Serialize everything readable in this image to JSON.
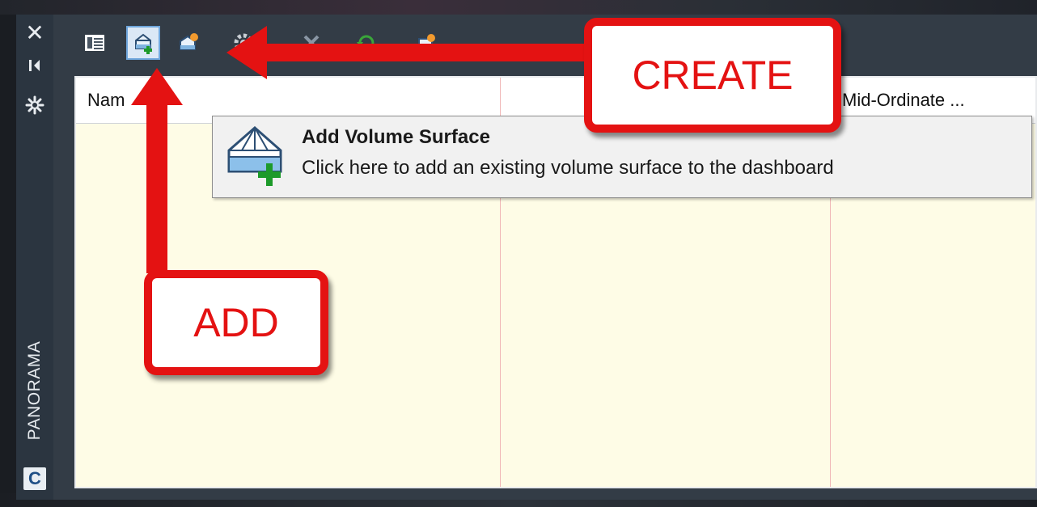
{
  "sidebar": {
    "title": "PANORAMA",
    "close_icon": "close-icon",
    "autohide_icon": "autohide-icon",
    "properties_icon": "properties-icon",
    "logo_letter": "C"
  },
  "toolbar": {
    "buttons": [
      {
        "icon": "panel-toggle-icon"
      },
      {
        "icon": "add-volume-surface-icon",
        "active": true
      },
      {
        "icon": "create-volume-surface-icon"
      },
      {
        "icon": "settings-icon"
      },
      {
        "icon": "delete-icon"
      },
      {
        "icon": "refresh-icon"
      },
      {
        "icon": "report-icon"
      }
    ]
  },
  "grid": {
    "columns": [
      "Nam",
      "",
      "Mid-Ordinate ..."
    ]
  },
  "tooltip": {
    "title": "Add Volume Surface",
    "description": "Click here to add an existing volume surface to the dashboard"
  },
  "annotations": {
    "create_label": "CREATE",
    "add_label": "ADD",
    "color": "#e41212"
  }
}
